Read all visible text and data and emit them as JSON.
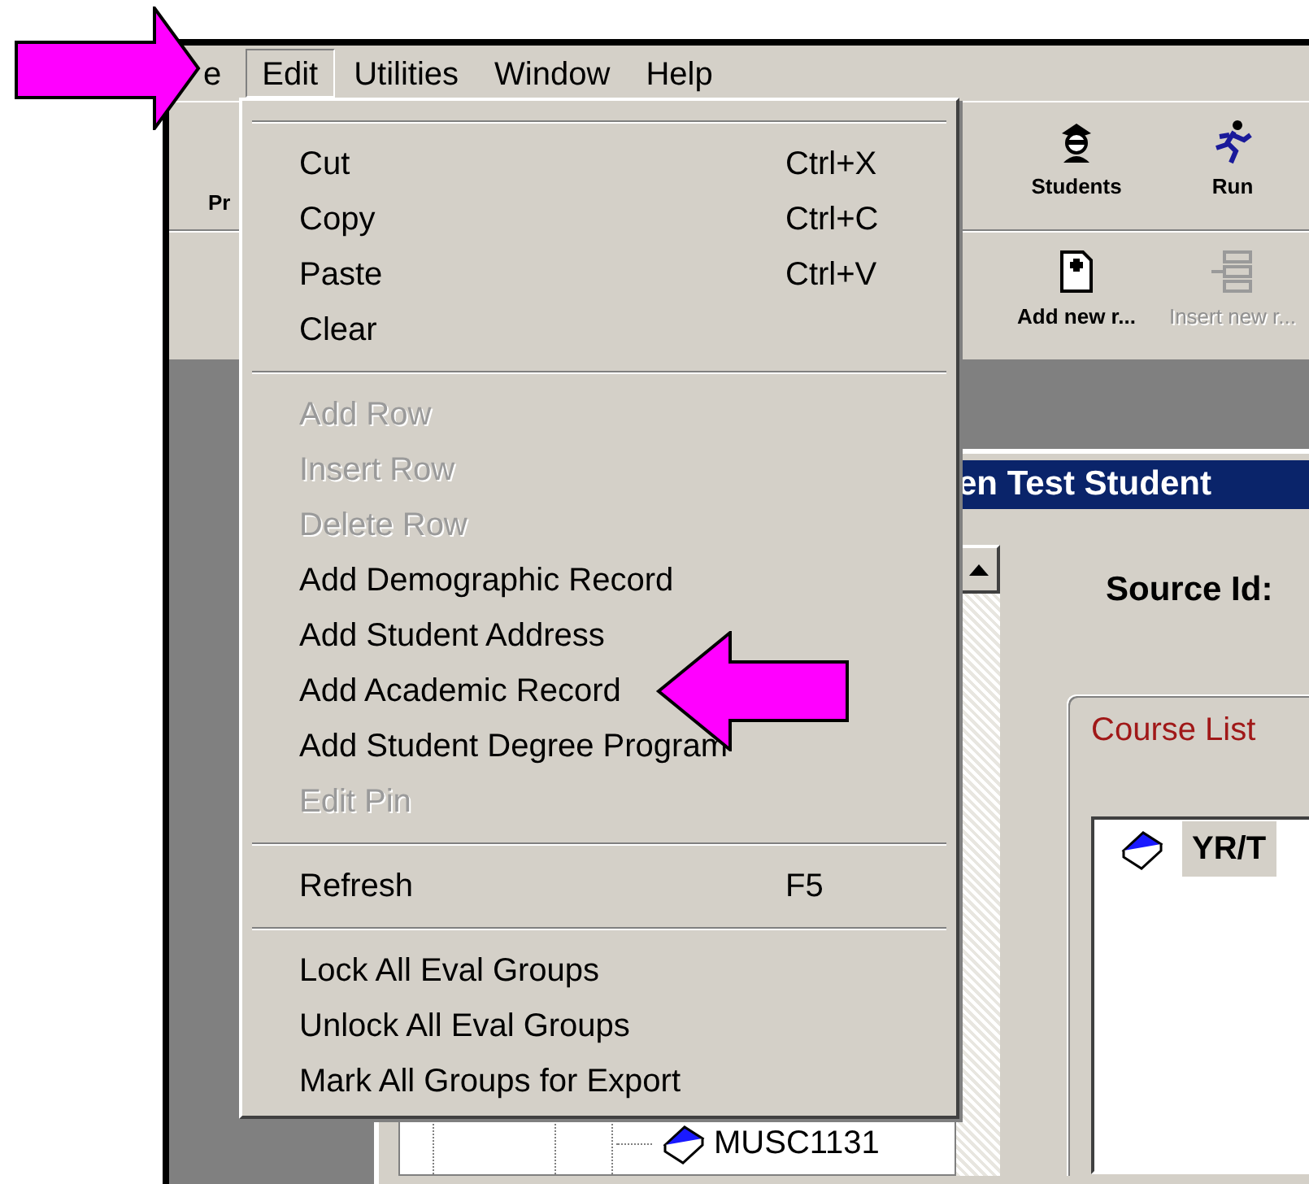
{
  "menu_bar": [
    {
      "label": "e",
      "selected": false
    },
    {
      "label": "Edit",
      "selected": true
    },
    {
      "label": "Utilities",
      "selected": false
    },
    {
      "label": "Window",
      "selected": false
    },
    {
      "label": "Help",
      "selected": false
    }
  ],
  "toolbar": {
    "left_label": "Pr",
    "buttons": [
      {
        "label": "Students",
        "kind": "student",
        "disabled": false
      },
      {
        "label": "Run",
        "kind": "run",
        "disabled": false
      }
    ]
  },
  "record_toolbar": {
    "buttons": [
      {
        "label": "Add new r...",
        "kind": "add",
        "disabled": false
      },
      {
        "label": "Insert new r...",
        "kind": "insert",
        "disabled": true
      }
    ]
  },
  "edit_menu": [
    {
      "kind": "item",
      "label": "Cut",
      "shortcut": "Ctrl+X",
      "disabled": false
    },
    {
      "kind": "item",
      "label": "Copy",
      "shortcut": "Ctrl+C",
      "disabled": false
    },
    {
      "kind": "item",
      "label": "Paste",
      "shortcut": "Ctrl+V",
      "disabled": false
    },
    {
      "kind": "item",
      "label": "Clear",
      "disabled": false
    },
    {
      "kind": "separator"
    },
    {
      "kind": "item",
      "label": "Add Row",
      "disabled": true
    },
    {
      "kind": "item",
      "label": "Insert Row",
      "disabled": true
    },
    {
      "kind": "item",
      "label": "Delete Row",
      "disabled": true
    },
    {
      "kind": "item",
      "label": "Add Demographic Record",
      "disabled": false
    },
    {
      "kind": "item",
      "label": "Add Student Address",
      "disabled": false
    },
    {
      "kind": "item",
      "label": "Add Academic Record",
      "disabled": false
    },
    {
      "kind": "item",
      "label": "Add Student Degree Program",
      "disabled": false
    },
    {
      "kind": "item",
      "label": "Edit Pin",
      "disabled": true
    },
    {
      "kind": "separator"
    },
    {
      "kind": "item",
      "label": "Refresh",
      "shortcut": "F5",
      "disabled": false
    },
    {
      "kind": "separator"
    },
    {
      "kind": "item",
      "label": "Lock All Eval Groups",
      "disabled": false
    },
    {
      "kind": "item",
      "label": "Unlock All Eval Groups",
      "disabled": false
    },
    {
      "kind": "item",
      "label": "Mark All Groups for Export",
      "disabled": false
    }
  ],
  "child_window": {
    "title": "en Test Student",
    "tree": {
      "items": [
        {
          "label": "MUSC1131"
        }
      ]
    },
    "source_id_label": "Source Id:",
    "course_list": {
      "title": "Course List",
      "columns": [
        "YR/T"
      ]
    }
  }
}
